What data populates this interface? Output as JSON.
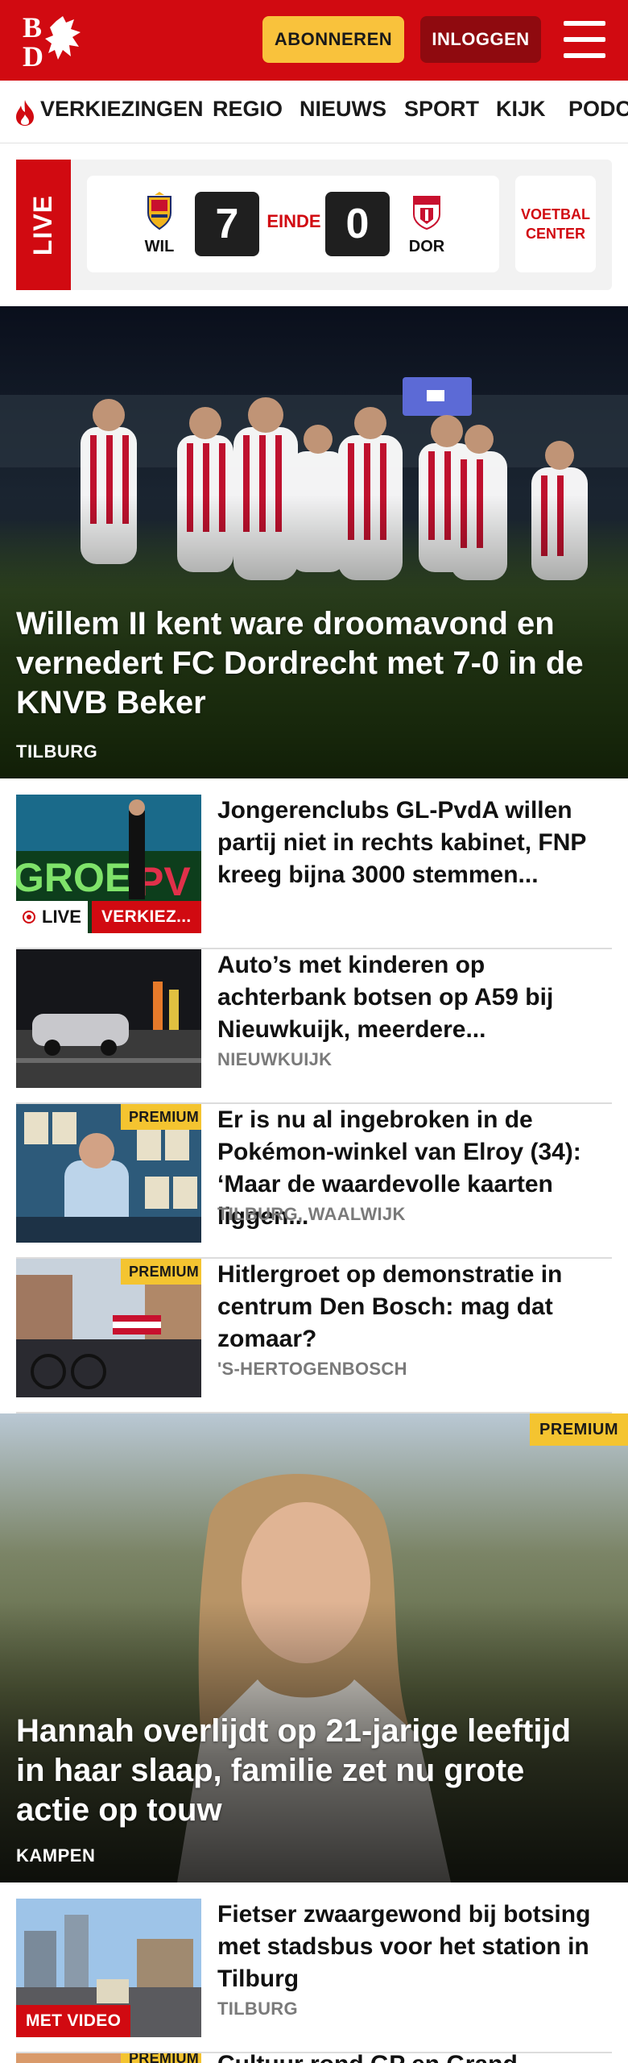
{
  "header": {
    "logo_text": "BD",
    "subscribe_label": "ABONNEREN",
    "login_label": "INLOGGEN",
    "menu_icon": "hamburger-menu-icon"
  },
  "nav": {
    "items": [
      "VERKIEZINGEN",
      "REGIO",
      "NIEUWS",
      "SPORT",
      "KIJK",
      "PODC"
    ],
    "first_item_icon": "flame-icon"
  },
  "live_match": {
    "badge": "LIVE",
    "home_team": "WIL",
    "away_team": "DOR",
    "home_score": "7",
    "away_score": "0",
    "status": "EINDE",
    "center_link": "VOETBAL CENTER"
  },
  "hero1": {
    "title": "Willem II kent ware droomavond en vernedert FC Dordrecht met 7-0 in de KNVB Beker",
    "location": "TILBURG"
  },
  "articles": [
    {
      "title": "Jongerenclubs GL-PvdA willen partij niet in rechts kabinet, FNP kreeg bijna 3000 stemmen...",
      "location": "",
      "live_label": "LIVE",
      "category_label": "VERKIEZ..."
    },
    {
      "title": "Auto’s met kinderen op achterbank botsen op A59 bij Nieuwkuijk, meerdere...",
      "location": "NIEUWKUIJK"
    },
    {
      "title": "Er is nu al ingebroken in de Poké­mon-winkel van Elroy (34): ‘Maar de waardevolle kaarten liggen...",
      "location": "TILBURG, WAALWIJK",
      "premium_label": "PREMIUM"
    },
    {
      "title": "Hitlergroet op demonstratie in centrum Den Bosch: mag dat zomaar?",
      "location": "'S-HERTOGENBOSCH",
      "premium_label": "PREMIUM"
    }
  ],
  "hero2": {
    "title": "Hannah overlijdt op 21-jarige leeftijd in haar slaap, familie zet nu grote actie op touw",
    "location": "KAMPEN",
    "premium_label": "PREMIUM"
  },
  "articles2": [
    {
      "title": "Fietser zwaargewond bij botsing met stadsbus voor het station in Tilburg",
      "location": "TILBURG",
      "video_label": "MET VIDEO"
    },
    {
      "title": "Cultuur rond GP en Grand...",
      "location": "",
      "premium_label": "PREMIUM"
    }
  ],
  "colors": {
    "brand_red": "#d10a11",
    "premium_yellow": "#f4c430",
    "subscribe_yellow": "#f9c23c",
    "login_dark_red": "#8f0a0f"
  }
}
